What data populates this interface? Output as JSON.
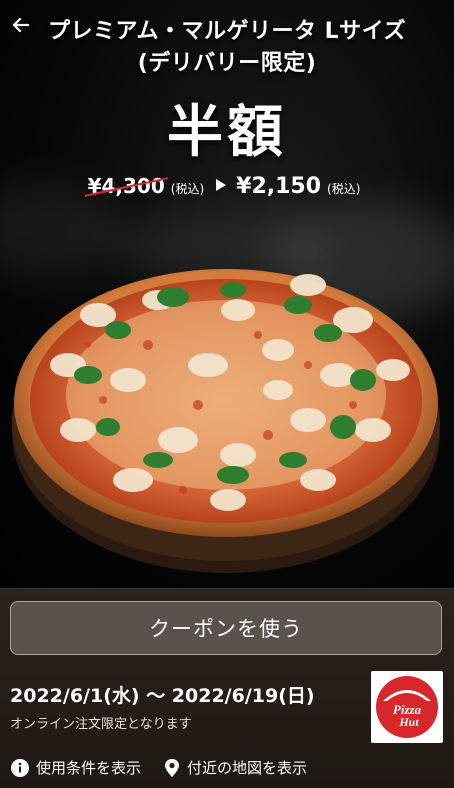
{
  "product": {
    "title_line1": "プレミアム・マルゲリータ Lサイズ",
    "title_line2": "(デリバリー限定)",
    "headline": "半額",
    "old_price": "¥4,300",
    "old_tax": "(税込)",
    "new_price": "¥2,150",
    "new_tax": "(税込)"
  },
  "coupon": {
    "button_label": "クーポンを使う",
    "period": "2022/6/1(水) 〜 2022/6/19(日)",
    "note": "オンライン注文限定となります"
  },
  "links": {
    "terms": "使用条件を表示",
    "map": "付近の地図を表示"
  },
  "brand": {
    "logo_text_line1": "Pizza",
    "logo_text_line2": "Hut",
    "logo_color": "#d8262b"
  },
  "icons": {
    "back": "back-arrow-icon",
    "info": "info-icon",
    "pin": "location-pin-icon"
  }
}
